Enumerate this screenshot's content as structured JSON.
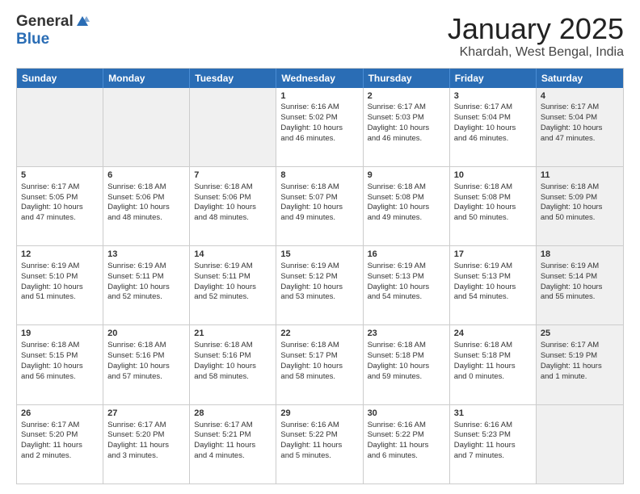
{
  "header": {
    "logo_general": "General",
    "logo_blue": "Blue",
    "month": "January 2025",
    "location": "Khardah, West Bengal, India"
  },
  "weekdays": [
    "Sunday",
    "Monday",
    "Tuesday",
    "Wednesday",
    "Thursday",
    "Friday",
    "Saturday"
  ],
  "weeks": [
    [
      {
        "day": "",
        "info": "",
        "shaded": true
      },
      {
        "day": "",
        "info": "",
        "shaded": true
      },
      {
        "day": "",
        "info": "",
        "shaded": true
      },
      {
        "day": "1",
        "info": "Sunrise: 6:16 AM\nSunset: 5:02 PM\nDaylight: 10 hours\nand 46 minutes.",
        "shaded": false
      },
      {
        "day": "2",
        "info": "Sunrise: 6:17 AM\nSunset: 5:03 PM\nDaylight: 10 hours\nand 46 minutes.",
        "shaded": false
      },
      {
        "day": "3",
        "info": "Sunrise: 6:17 AM\nSunset: 5:04 PM\nDaylight: 10 hours\nand 46 minutes.",
        "shaded": false
      },
      {
        "day": "4",
        "info": "Sunrise: 6:17 AM\nSunset: 5:04 PM\nDaylight: 10 hours\nand 47 minutes.",
        "shaded": true
      }
    ],
    [
      {
        "day": "5",
        "info": "Sunrise: 6:17 AM\nSunset: 5:05 PM\nDaylight: 10 hours\nand 47 minutes.",
        "shaded": false
      },
      {
        "day": "6",
        "info": "Sunrise: 6:18 AM\nSunset: 5:06 PM\nDaylight: 10 hours\nand 48 minutes.",
        "shaded": false
      },
      {
        "day": "7",
        "info": "Sunrise: 6:18 AM\nSunset: 5:06 PM\nDaylight: 10 hours\nand 48 minutes.",
        "shaded": false
      },
      {
        "day": "8",
        "info": "Sunrise: 6:18 AM\nSunset: 5:07 PM\nDaylight: 10 hours\nand 49 minutes.",
        "shaded": false
      },
      {
        "day": "9",
        "info": "Sunrise: 6:18 AM\nSunset: 5:08 PM\nDaylight: 10 hours\nand 49 minutes.",
        "shaded": false
      },
      {
        "day": "10",
        "info": "Sunrise: 6:18 AM\nSunset: 5:08 PM\nDaylight: 10 hours\nand 50 minutes.",
        "shaded": false
      },
      {
        "day": "11",
        "info": "Sunrise: 6:18 AM\nSunset: 5:09 PM\nDaylight: 10 hours\nand 50 minutes.",
        "shaded": true
      }
    ],
    [
      {
        "day": "12",
        "info": "Sunrise: 6:19 AM\nSunset: 5:10 PM\nDaylight: 10 hours\nand 51 minutes.",
        "shaded": false
      },
      {
        "day": "13",
        "info": "Sunrise: 6:19 AM\nSunset: 5:11 PM\nDaylight: 10 hours\nand 52 minutes.",
        "shaded": false
      },
      {
        "day": "14",
        "info": "Sunrise: 6:19 AM\nSunset: 5:11 PM\nDaylight: 10 hours\nand 52 minutes.",
        "shaded": false
      },
      {
        "day": "15",
        "info": "Sunrise: 6:19 AM\nSunset: 5:12 PM\nDaylight: 10 hours\nand 53 minutes.",
        "shaded": false
      },
      {
        "day": "16",
        "info": "Sunrise: 6:19 AM\nSunset: 5:13 PM\nDaylight: 10 hours\nand 54 minutes.",
        "shaded": false
      },
      {
        "day": "17",
        "info": "Sunrise: 6:19 AM\nSunset: 5:13 PM\nDaylight: 10 hours\nand 54 minutes.",
        "shaded": false
      },
      {
        "day": "18",
        "info": "Sunrise: 6:19 AM\nSunset: 5:14 PM\nDaylight: 10 hours\nand 55 minutes.",
        "shaded": true
      }
    ],
    [
      {
        "day": "19",
        "info": "Sunrise: 6:18 AM\nSunset: 5:15 PM\nDaylight: 10 hours\nand 56 minutes.",
        "shaded": false
      },
      {
        "day": "20",
        "info": "Sunrise: 6:18 AM\nSunset: 5:16 PM\nDaylight: 10 hours\nand 57 minutes.",
        "shaded": false
      },
      {
        "day": "21",
        "info": "Sunrise: 6:18 AM\nSunset: 5:16 PM\nDaylight: 10 hours\nand 58 minutes.",
        "shaded": false
      },
      {
        "day": "22",
        "info": "Sunrise: 6:18 AM\nSunset: 5:17 PM\nDaylight: 10 hours\nand 58 minutes.",
        "shaded": false
      },
      {
        "day": "23",
        "info": "Sunrise: 6:18 AM\nSunset: 5:18 PM\nDaylight: 10 hours\nand 59 minutes.",
        "shaded": false
      },
      {
        "day": "24",
        "info": "Sunrise: 6:18 AM\nSunset: 5:18 PM\nDaylight: 11 hours\nand 0 minutes.",
        "shaded": false
      },
      {
        "day": "25",
        "info": "Sunrise: 6:17 AM\nSunset: 5:19 PM\nDaylight: 11 hours\nand 1 minute.",
        "shaded": true
      }
    ],
    [
      {
        "day": "26",
        "info": "Sunrise: 6:17 AM\nSunset: 5:20 PM\nDaylight: 11 hours\nand 2 minutes.",
        "shaded": false
      },
      {
        "day": "27",
        "info": "Sunrise: 6:17 AM\nSunset: 5:20 PM\nDaylight: 11 hours\nand 3 minutes.",
        "shaded": false
      },
      {
        "day": "28",
        "info": "Sunrise: 6:17 AM\nSunset: 5:21 PM\nDaylight: 11 hours\nand 4 minutes.",
        "shaded": false
      },
      {
        "day": "29",
        "info": "Sunrise: 6:16 AM\nSunset: 5:22 PM\nDaylight: 11 hours\nand 5 minutes.",
        "shaded": false
      },
      {
        "day": "30",
        "info": "Sunrise: 6:16 AM\nSunset: 5:22 PM\nDaylight: 11 hours\nand 6 minutes.",
        "shaded": false
      },
      {
        "day": "31",
        "info": "Sunrise: 6:16 AM\nSunset: 5:23 PM\nDaylight: 11 hours\nand 7 minutes.",
        "shaded": false
      },
      {
        "day": "",
        "info": "",
        "shaded": true
      }
    ]
  ]
}
